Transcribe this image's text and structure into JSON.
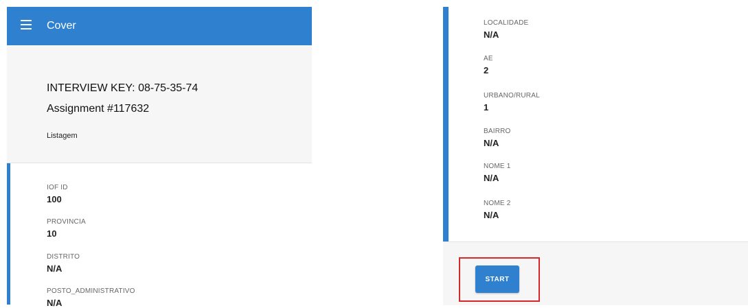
{
  "header": {
    "title": "Cover"
  },
  "cover": {
    "interview_key": "INTERVIEW KEY: 08-75-35-74",
    "assignment": "Assignment #117632",
    "section_title": "Listagem"
  },
  "left_fields": [
    {
      "label": "IOF ID",
      "value": "100"
    },
    {
      "label": "PROVINCIA",
      "value": "10"
    },
    {
      "label": "DISTRITO",
      "value": "N/A"
    },
    {
      "label": "POSTO_ADMINISTRATIVO",
      "value": "N/A"
    }
  ],
  "right_fields": [
    {
      "label": "LOCALIDADE",
      "value": "N/A"
    },
    {
      "label": "AE",
      "value": "2"
    },
    {
      "label": "URBANO/RURAL",
      "value": "1"
    },
    {
      "label": "BAIRRO",
      "value": "N/A"
    },
    {
      "label": "NOME 1",
      "value": "N/A"
    },
    {
      "label": "NOME 2",
      "value": "N/A"
    }
  ],
  "actions": {
    "start_label": "START"
  },
  "colors": {
    "accent": "#2f80cf",
    "highlight": "#d9262b",
    "panel_bg": "#f6f6f6"
  },
  "icons": {
    "menu": "hamburger-menu-icon"
  }
}
